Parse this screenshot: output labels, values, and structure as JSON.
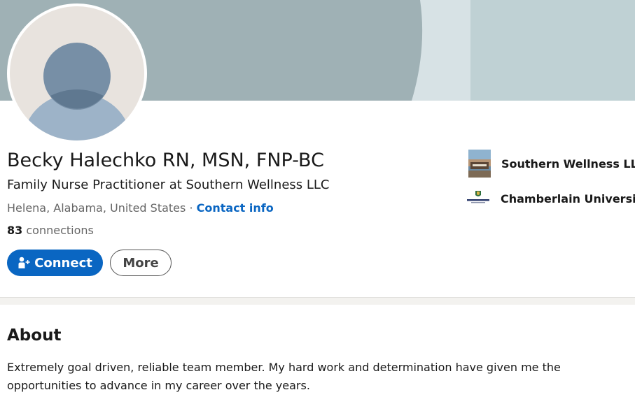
{
  "profile": {
    "name": "Becky Halechko RN, MSN, FNP-BC",
    "headline": "Family Nurse Practitioner at Southern Wellness LLC",
    "location": "Helena, Alabama, United States",
    "separator": "·",
    "contact_label": "Contact info",
    "connections_count": "83",
    "connections_label": "connections"
  },
  "actions": {
    "connect_label": "Connect",
    "more_label": "More"
  },
  "organizations": [
    {
      "name": "Southern Wellness LLC",
      "logo_icon": "building-photo-icon"
    },
    {
      "name": "Chamberlain University",
      "logo_icon": "chamberlain-logo-icon"
    }
  ],
  "about": {
    "title": "About",
    "text": "Extremely goal driven, reliable team member. My hard work and determination have given me the opportunities to advance in my career over the years."
  },
  "colors": {
    "primary": "#0a66c2",
    "banner": "#9fb1b5",
    "avatar_bg": "#e8e3de",
    "avatar_head": "#778fa6",
    "avatar_body": "#9db3c8"
  }
}
